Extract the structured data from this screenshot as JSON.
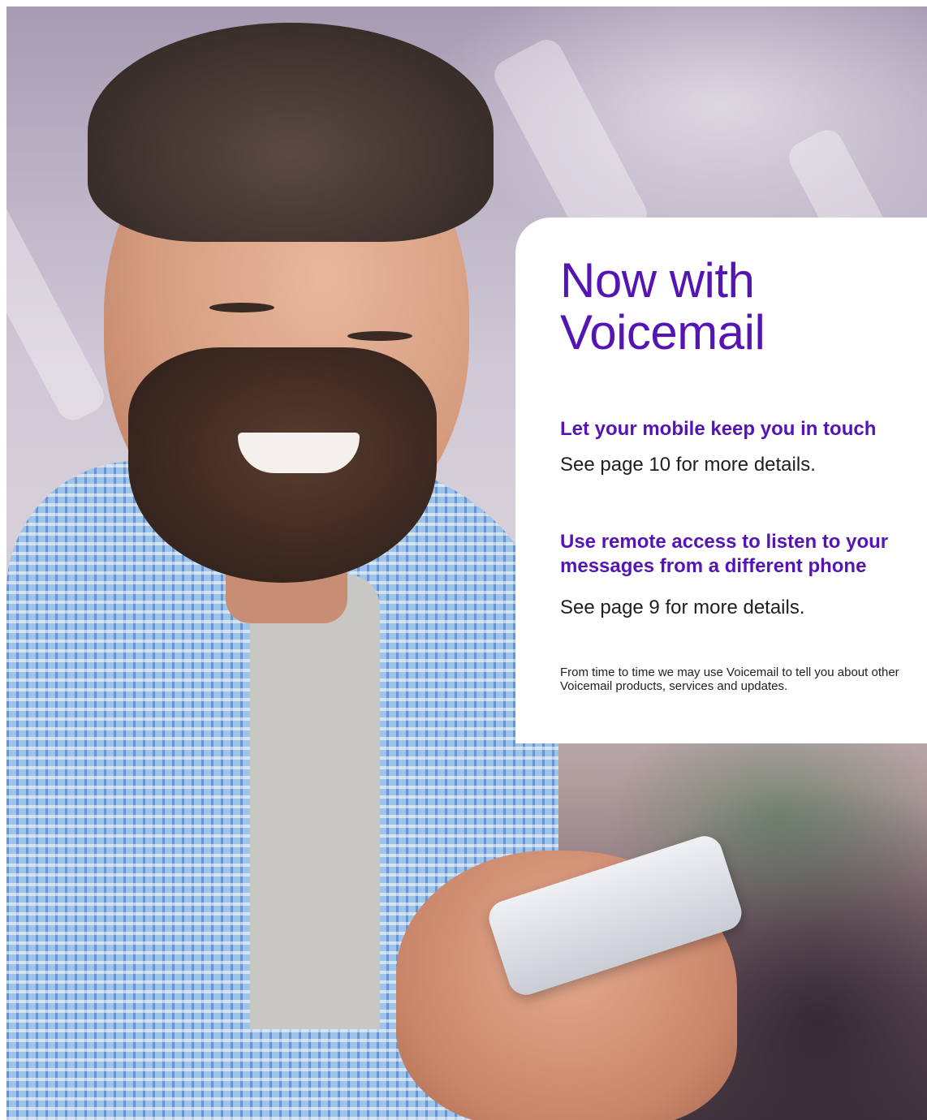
{
  "card": {
    "title_line1": "Now with",
    "title_line2": "Voicemail",
    "feature1": {
      "heading": "Let your mobile keep you in touch",
      "detail": "See page 10 for more details."
    },
    "feature2": {
      "heading_line1": "Use remote access to listen to your",
      "heading_line2": "messages from a different phone",
      "detail": "See page 9 for more details."
    },
    "disclaimer": "From time to time we may use Voicemail to tell you about other Voicemail products, services and updates."
  },
  "colors": {
    "brand_purple": "#5514b4",
    "body_text": "#1f1f1f"
  }
}
